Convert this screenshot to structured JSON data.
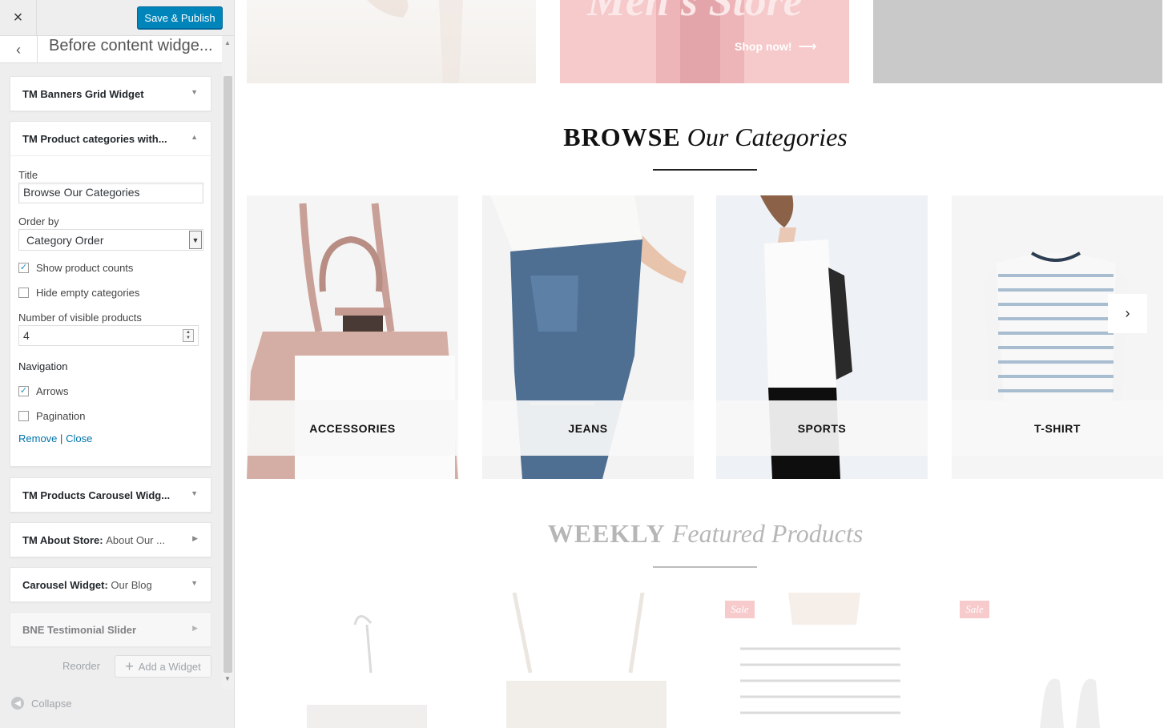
{
  "topbar": {
    "close_icon": "×",
    "publish_label": "Save & Publish"
  },
  "section": {
    "back_icon": "‹",
    "title": "Before content widge..."
  },
  "widgets": {
    "banners": {
      "title": "TM Banners Grid Widget"
    },
    "categories": {
      "title": "TM Product categories with...",
      "title_label": "Title",
      "title_value": "Browse Our Categories",
      "order_label": "Order by",
      "order_value": "Category Order",
      "show_counts_label": "Show product counts",
      "show_counts_checked": true,
      "hide_empty_label": "Hide empty categories",
      "hide_empty_checked": false,
      "visible_label": "Number of visible products",
      "visible_value": "4",
      "navigation_label": "Navigation",
      "arrows_label": "Arrows",
      "arrows_checked": true,
      "pagination_label": "Pagination",
      "pagination_checked": false,
      "remove_label": "Remove",
      "separator": "|",
      "close_label": "Close"
    },
    "carousel": {
      "title": "TM Products Carousel Widg..."
    },
    "about": {
      "title": "TM About Store:",
      "subtitle": "About Our ..."
    },
    "blog": {
      "title": "Carousel Widget:",
      "subtitle": "Our Blog"
    },
    "testimonial": {
      "title": "BNE Testimonial Slider"
    }
  },
  "tools": {
    "reorder_label": "Reorder",
    "add_widget_label": "Add a Widget",
    "collapse_label": "Collapse"
  },
  "preview": {
    "banner2_text": "Men's Store",
    "banner2_shop": "Shop now!",
    "browse_bold": "BROWSE",
    "browse_italic": "Our Categories",
    "categories": [
      "ACCESSORIES",
      "JEANS",
      "SPORTS",
      "T-SHIRT"
    ],
    "next_arrow": "›",
    "weekly_bold": "WEEKLY",
    "weekly_italic": "Featured Products",
    "sale_label": "Sale"
  },
  "colors": {
    "accent": "#0085ba",
    "link": "#0073aa",
    "sale": "#f2a0a4",
    "banner_pink": "#f6c9cb"
  }
}
